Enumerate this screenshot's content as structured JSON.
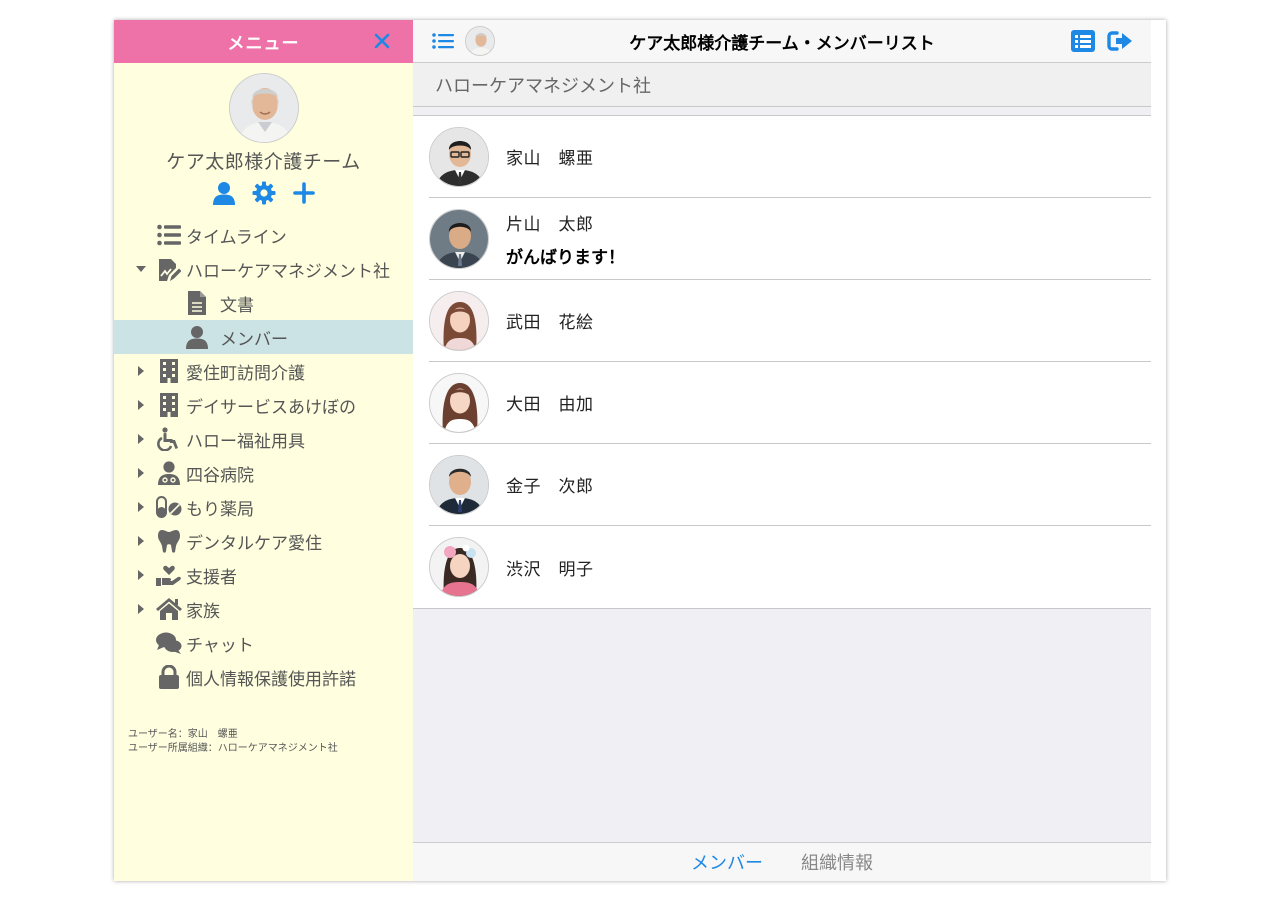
{
  "sidebar": {
    "header_title": "メニュー",
    "team_name": "ケア太郎様介護チーム",
    "nav": {
      "timeline": "タイムライン",
      "hello_care": "ハローケアマネジメント社",
      "documents": "文書",
      "members": "メンバー",
      "aizumi_visit": "愛住町訪問介護",
      "day_service": "デイサービスあけぼの",
      "hello_welfare": "ハロー福祉用具",
      "yotsuya_hospital": "四谷病院",
      "mori_pharmacy": "もり薬局",
      "dental_care": "デンタルケア愛住",
      "supporters": "支援者",
      "family": "家族",
      "chat": "チャット",
      "privacy_consent": "個人情報保護使用許諾"
    },
    "user_info": {
      "user_name_line": "ユーザー名：家山　螺亜",
      "user_org_line": "ユーザー所属組織：ハローケアマネジメント社"
    }
  },
  "topbar": {
    "title": "ケア太郎様介護チーム・メンバーリスト"
  },
  "org_bar": {
    "label": "ハローケアマネジメント社"
  },
  "members": [
    {
      "name": "家山　螺亜",
      "message": ""
    },
    {
      "name": "片山　太郎",
      "message": "がんばります！"
    },
    {
      "name": "武田　花絵",
      "message": ""
    },
    {
      "name": "大田　由加",
      "message": ""
    },
    {
      "name": "金子　次郎",
      "message": ""
    },
    {
      "name": "渋沢　明子",
      "message": ""
    }
  ],
  "bottom_tabs": {
    "members": "メンバー",
    "org_info": "組織情報"
  },
  "colors": {
    "sidebar_header": "#ee72a8",
    "sidebar_bg": "#ffffe0",
    "active_nav": "#cce3e6",
    "accent_blue": "#1e88e5",
    "icon_gray": "#666666"
  },
  "icons": {
    "close": "close-icon",
    "user": "user-icon",
    "gear": "gear-icon",
    "plus": "plus-icon",
    "list": "list-icon",
    "logout": "logout-icon"
  }
}
